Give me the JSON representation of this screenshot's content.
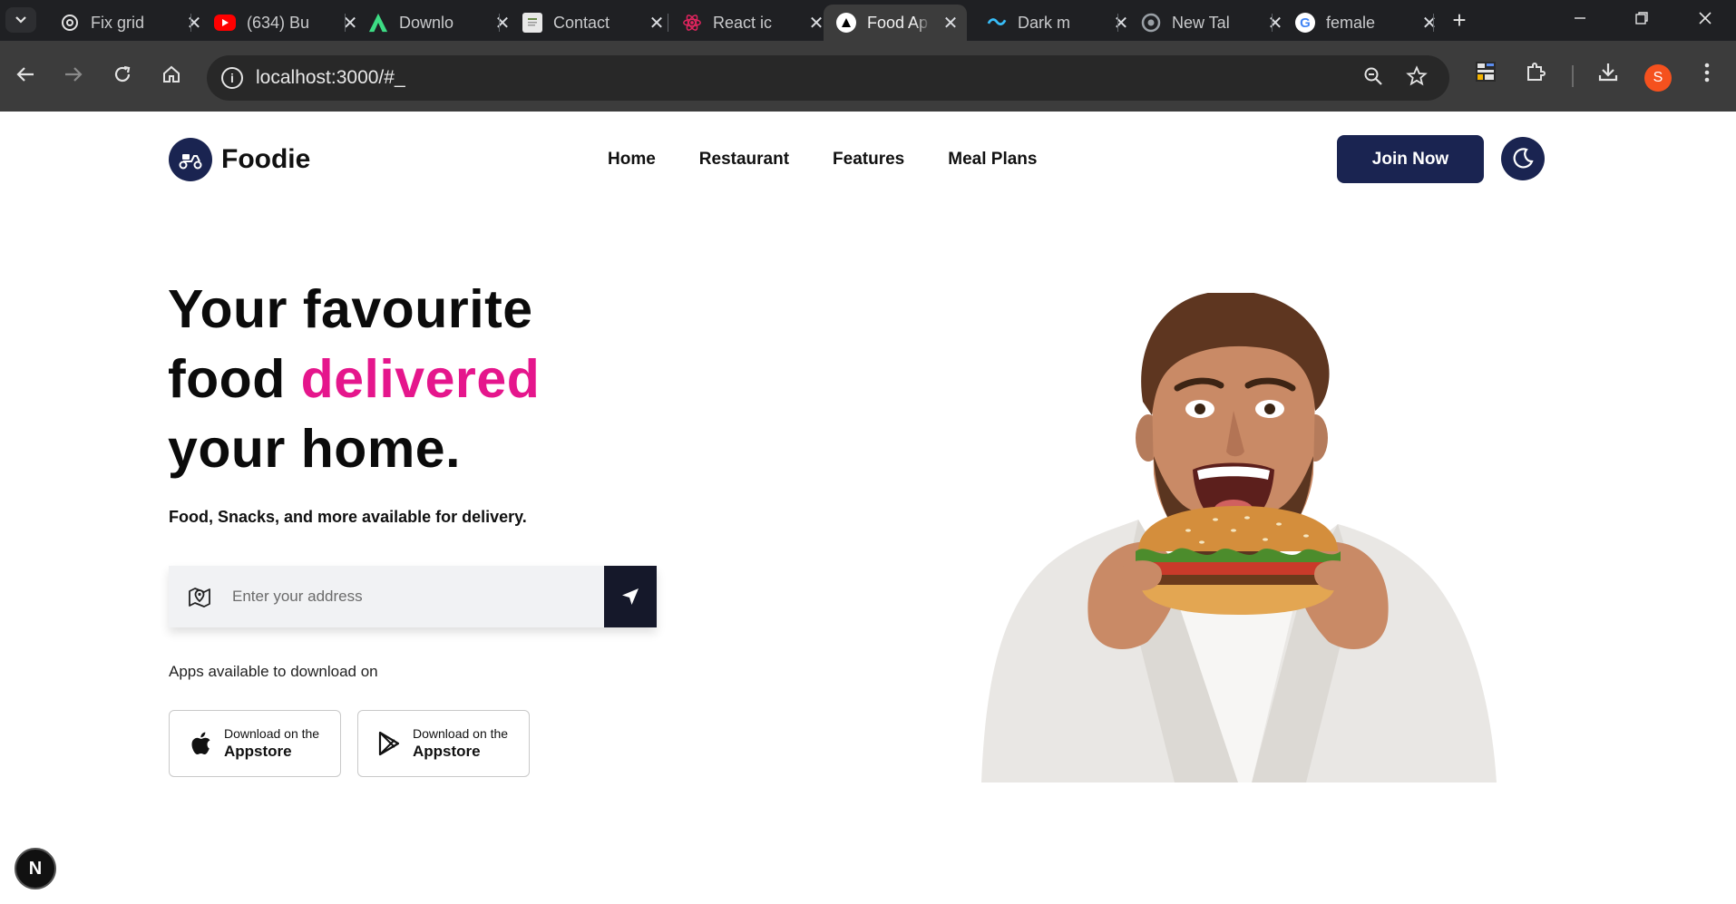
{
  "browser": {
    "tabs": [
      {
        "title": "Fix grid",
        "favicon": "openai-icon",
        "color": "#1f2023"
      },
      {
        "title": "(634) Bu",
        "favicon": "youtube-icon",
        "color": "#ff0000"
      },
      {
        "title": "Downlo",
        "favicon": "android-studio-icon",
        "color": "#3ddc84"
      },
      {
        "title": "Contact",
        "favicon": "document-icon",
        "color": "#e8e8e8"
      },
      {
        "title": "React ic",
        "favicon": "react-icon",
        "color": "#e0245e"
      },
      {
        "title": "Food Ap",
        "favicon": "nextjs-icon",
        "color": "#ffffff",
        "active": true
      },
      {
        "title": "Dark m",
        "favicon": "tailwind-icon",
        "color": "#38bdf8"
      },
      {
        "title": "New Tal",
        "favicon": "chrome-icon",
        "color": "#9aa0a6"
      },
      {
        "title": "female",
        "favicon": "google-icon",
        "color": "#4285f4"
      }
    ],
    "url": "localhost:3000/#_",
    "profile_initial": "S"
  },
  "nav": {
    "brand": "Foodie",
    "links": [
      "Home",
      "Restaurant",
      "Features",
      "Meal Plans"
    ],
    "cta": "Join Now"
  },
  "hero": {
    "title_line1": "Your favourite",
    "title_line2a": "food ",
    "title_line2b": "delivered",
    "title_line3": "your home.",
    "subtitle": "Food, Snacks, and more available for delivery.",
    "address_placeholder": "Enter your address",
    "apps_label": "Apps available to download on",
    "stores": [
      {
        "small": "Download on the",
        "big": "Appstore",
        "icon": "apple-icon"
      },
      {
        "small": "Download on the",
        "big": "Appstore",
        "icon": "play-store-icon"
      }
    ]
  },
  "dev": {
    "badge": "N"
  },
  "colors": {
    "brand": "#1a2451",
    "accent": "#e5168c"
  }
}
